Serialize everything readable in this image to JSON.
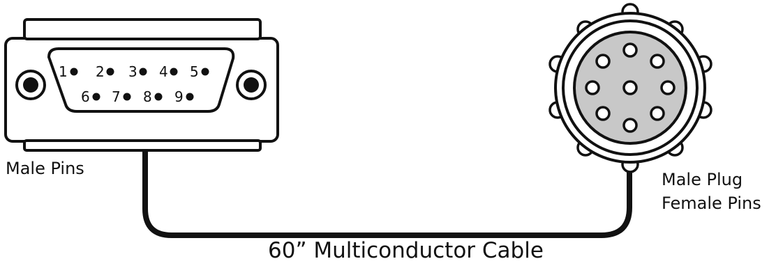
{
  "labels": {
    "left_connector": "Male Pins",
    "right_connector_line1": "Male Plug",
    "right_connector_line2": "Female Pins",
    "cable": "60” Multiconductor Cable"
  },
  "db9_pins_top": [
    "1",
    "2",
    "3",
    "4",
    "5"
  ],
  "db9_pins_bottom": [
    "6",
    "7",
    "8",
    "9"
  ],
  "colors": {
    "stroke": "#111111",
    "plug_face": "#c8c8c8",
    "background": "#ffffff"
  }
}
